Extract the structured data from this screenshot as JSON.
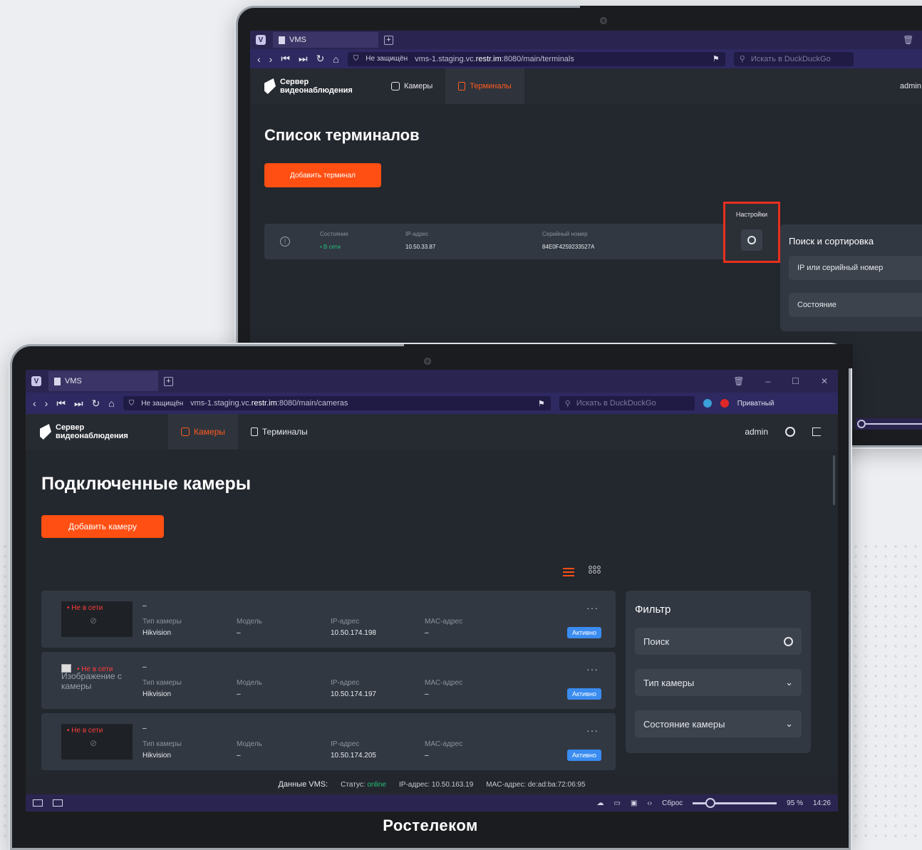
{
  "back": {
    "tab_title": "VMS",
    "not_secure": "Не защищён",
    "url_prefix": "vms-1.staging.vc.",
    "url_host": "restr.im",
    "url_suffix": ":8080/main/terminals",
    "search_placeholder": "Искать в DuckDuckGo",
    "brand_line1": "Сервер",
    "brand_line2": "видеонаблюдения",
    "nav_cameras": "Камеры",
    "nav_terminals": "Терминалы",
    "user": "admin",
    "page_title": "Список терминалов",
    "add_button": "Добавить терминал",
    "tooltip": "Настройки",
    "row": {
      "state_label": "Состояние",
      "state_value": "• В сети",
      "ip_label": "IP-адрес",
      "ip_value": "10.50.33.87",
      "serial_label": "Серийный номер",
      "serial_value": "84E0F4259233527A"
    },
    "side": {
      "title": "Поиск и сортировка",
      "search_placeholder": "IP или серийный номер",
      "state_select": "Состояние"
    }
  },
  "front": {
    "tab_title": "VMS",
    "not_secure": "Не защищён",
    "url_prefix": "vms-1.staging.vc.",
    "url_host": "restr.im",
    "url_suffix": ":8080/main/cameras",
    "search_placeholder": "Искать в DuckDuckGo",
    "private": "Приватный",
    "brand_line1": "Сервер",
    "brand_line2": "видеонаблюдения",
    "nav_cameras": "Камеры",
    "nav_terminals": "Терминалы",
    "user": "admin",
    "page_title": "Подключенные камеры",
    "add_button": "Добавить камеру",
    "labels": {
      "type": "Тип камеры",
      "model": "Модель",
      "ip": "IP-адрес",
      "mac": "MAC-адрес",
      "offline": "• Не в сети",
      "active": "Активно",
      "broken_img": "Изображение с камеры"
    },
    "cameras": [
      {
        "name": "–",
        "type": "Hikvision",
        "model": "–",
        "ip": "10.50.174.198",
        "mac": "–"
      },
      {
        "name": "–",
        "type": "Hikvision",
        "model": "–",
        "ip": "10.50.174.197",
        "mac": "–"
      },
      {
        "name": "–",
        "type": "Hikvision",
        "model": "–",
        "ip": "10.50.174.205",
        "mac": "–"
      }
    ],
    "filter": {
      "title": "Фильтр",
      "search": "Поиск",
      "camera_type": "Тип камеры",
      "camera_state": "Состояние камеры"
    },
    "vms": {
      "label": "Данные VMS:",
      "status_label": "Статус:",
      "status_value": "online",
      "ip": "IP-адрес: 10.50.163.19",
      "mac": "MAC-адрес: de:ad:ba:72:06:95"
    },
    "bottom": {
      "reset": "Сброс",
      "zoom": "95 %",
      "time": "14:26"
    }
  },
  "footer_brand": "Ростелеком",
  "colors": {
    "accent": "#ff4f12",
    "online": "#22c07a",
    "active_badge": "#3a8cf0",
    "offline": "#ff3b3b"
  }
}
